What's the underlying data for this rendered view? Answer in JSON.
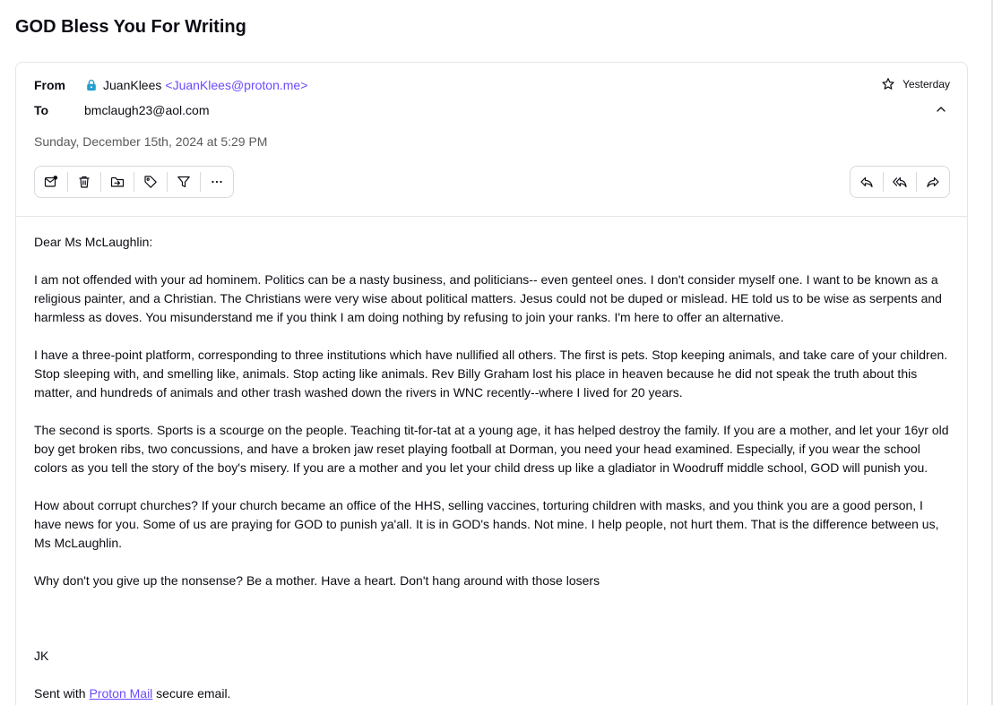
{
  "subject": "GOD Bless You For Writing",
  "header": {
    "from_label": "From",
    "sender_name": "JuanKlees",
    "sender_email": "<JuanKlees@proton.me>",
    "to_label": "To",
    "recipient": "bmclaugh23@aol.com",
    "date": "Sunday, December 15th, 2024 at 5:29 PM",
    "time_ago": "Yesterday"
  },
  "toolbar_left": [
    "mark-unread-icon",
    "trash-icon",
    "move-to-folder-icon",
    "label-tag-icon",
    "filter-icon",
    "more-options-icon"
  ],
  "toolbar_right": [
    "reply-icon",
    "reply-all-icon",
    "forward-icon"
  ],
  "body": {
    "greeting": "Dear Ms McLaughlin:",
    "p1": "I am not offended with your ad hominem. Politics can be a nasty business, and politicians-- even genteel ones.  I don't consider myself one. I want to be known as a religious painter, and a Christian. The Christians were very wise about political matters. Jesus could not be duped or mislead. HE told us to be wise as serpents and harmless as doves. You misunderstand me if you think  I am doing nothing by refusing to join your ranks.  I'm here to offer an alternative.",
    "p2": "I have a three-point platform, corresponding to three institutions which have nullified all others. The first is pets. Stop keeping animals, and take care of your children. Stop sleeping with, and smelling like, animals. Stop acting like animals.  Rev Billy Graham lost his place in heaven because he did not speak the truth about this matter, and hundreds of animals and other trash washed down the rivers in WNC recently--where I lived for 20 years.",
    "p3": "The second is sports. Sports is a scourge on the people. Teaching tit-for-tat at a young age, it has helped destroy the family. If you are a mother, and let your 16yr old boy get broken ribs, two concussions, and have a broken jaw reset playing football at Dorman, you need your head examined. Especially, if you wear the school colors as you tell the story of the boy's misery. If you are a mother and you let your child dress up like a gladiator in Woodruff middle school, GOD will punish you.",
    "p4": "How about corrupt churches? If your church became an office of the HHS, selling vaccines, torturing children with masks, and you think you are a good person, I have news for you. Some of us are praying for GOD to punish ya'all. It is in GOD's hands. Not mine. I help people, not hurt them. That is the difference between us, Ms McLaughlin.",
    "p5": "Why don't you give up the nonsense? Be a mother. Have a heart. Don't hang around with those losers",
    "signature": "JK",
    "sent_prefix": "Sent with ",
    "sent_link": "Proton Mail",
    "sent_suffix": " secure email."
  },
  "colors": {
    "accent": "#6d4aff",
    "lock": "#239ece",
    "border": "#e5e5ea",
    "muted_text": "#5c5958"
  }
}
